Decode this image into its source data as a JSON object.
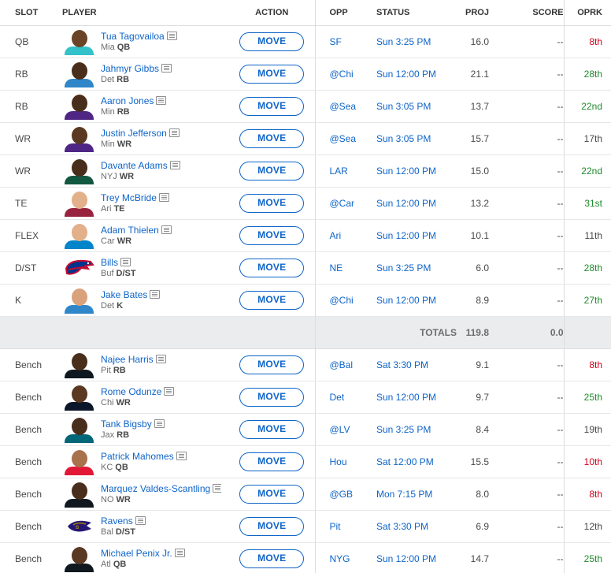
{
  "headers": {
    "slot": "SLOT",
    "player": "PLAYER",
    "action": "ACTION",
    "opp": "OPP",
    "status": "STATUS",
    "proj": "PROJ",
    "score": "SCORE",
    "oprk": "OPRK"
  },
  "move_label": "MOVE",
  "totals": {
    "label": "TOTALS",
    "proj": "119.8",
    "score": "0.0"
  },
  "starters": [
    {
      "slot": "QB",
      "name": "Tua Tagovailoa",
      "team": "Mia",
      "pos": "QB",
      "opp": "SF",
      "status": "Sun 3:25 PM",
      "proj": "16.0",
      "score": "--",
      "oprk": "8th",
      "oprk_tone": "red",
      "avatar": "headshot",
      "skin": "#6b4427",
      "jersey": "#33c2c9"
    },
    {
      "slot": "RB",
      "name": "Jahmyr Gibbs",
      "team": "Det",
      "pos": "RB",
      "opp": "@Chi",
      "status": "Sun 12:00 PM",
      "proj": "21.1",
      "score": "--",
      "oprk": "28th",
      "oprk_tone": "green",
      "avatar": "headshot",
      "skin": "#4a2e1c",
      "jersey": "#2f86c9"
    },
    {
      "slot": "RB",
      "name": "Aaron Jones",
      "team": "Min",
      "pos": "RB",
      "opp": "@Sea",
      "status": "Sun 3:05 PM",
      "proj": "13.7",
      "score": "--",
      "oprk": "22nd",
      "oprk_tone": "green",
      "avatar": "headshot",
      "skin": "#4a2e1c",
      "jersey": "#4f2683"
    },
    {
      "slot": "WR",
      "name": "Justin Jefferson",
      "team": "Min",
      "pos": "WR",
      "opp": "@Sea",
      "status": "Sun 3:05 PM",
      "proj": "15.7",
      "score": "--",
      "oprk": "17th",
      "oprk_tone": "neutral",
      "avatar": "headshot",
      "skin": "#5a3822",
      "jersey": "#4f2683"
    },
    {
      "slot": "WR",
      "name": "Davante Adams",
      "team": "NYJ",
      "pos": "WR",
      "opp": "LAR",
      "status": "Sun 12:00 PM",
      "proj": "15.0",
      "score": "--",
      "oprk": "22nd",
      "oprk_tone": "green",
      "avatar": "headshot",
      "skin": "#4a2e1c",
      "jersey": "#125740"
    },
    {
      "slot": "TE",
      "name": "Trey McBride",
      "team": "Ari",
      "pos": "TE",
      "opp": "@Car",
      "status": "Sun 12:00 PM",
      "proj": "13.2",
      "score": "--",
      "oprk": "31st",
      "oprk_tone": "green",
      "avatar": "headshot",
      "skin": "#e2b08a",
      "jersey": "#97233f"
    },
    {
      "slot": "FLEX",
      "name": "Adam Thielen",
      "team": "Car",
      "pos": "WR",
      "opp": "Ari",
      "status": "Sun 12:00 PM",
      "proj": "10.1",
      "score": "--",
      "oprk": "11th",
      "oprk_tone": "neutral",
      "avatar": "headshot",
      "skin": "#e2b08a",
      "jersey": "#0085ca"
    },
    {
      "slot": "D/ST",
      "name": "Bills",
      "team": "Buf",
      "pos": "D/ST",
      "opp": "NE",
      "status": "Sun 3:25 PM",
      "proj": "6.0",
      "score": "--",
      "oprk": "28th",
      "oprk_tone": "green",
      "avatar": "bills-logo",
      "skin": "",
      "jersey": ""
    },
    {
      "slot": "K",
      "name": "Jake Bates",
      "team": "Det",
      "pos": "K",
      "opp": "@Chi",
      "status": "Sun 12:00 PM",
      "proj": "8.9",
      "score": "--",
      "oprk": "27th",
      "oprk_tone": "green",
      "avatar": "headshot",
      "skin": "#d9a27c",
      "jersey": "#2f86c9"
    }
  ],
  "bench": [
    {
      "slot": "Bench",
      "name": "Najee Harris",
      "team": "Pit",
      "pos": "RB",
      "opp": "@Bal",
      "status": "Sat 3:30 PM",
      "proj": "9.1",
      "score": "--",
      "oprk": "8th",
      "oprk_tone": "red",
      "avatar": "headshot",
      "skin": "#4a2e1c",
      "jersey": "#101820"
    },
    {
      "slot": "Bench",
      "name": "Rome Odunze",
      "team": "Chi",
      "pos": "WR",
      "opp": "Det",
      "status": "Sun 12:00 PM",
      "proj": "9.7",
      "score": "--",
      "oprk": "25th",
      "oprk_tone": "green",
      "avatar": "headshot",
      "skin": "#5a3822",
      "jersey": "#0b162a"
    },
    {
      "slot": "Bench",
      "name": "Tank Bigsby",
      "team": "Jax",
      "pos": "RB",
      "opp": "@LV",
      "status": "Sun 3:25 PM",
      "proj": "8.4",
      "score": "--",
      "oprk": "19th",
      "oprk_tone": "neutral",
      "avatar": "headshot",
      "skin": "#4a2e1c",
      "jersey": "#006778"
    },
    {
      "slot": "Bench",
      "name": "Patrick Mahomes",
      "team": "KC",
      "pos": "QB",
      "opp": "Hou",
      "status": "Sat 12:00 PM",
      "proj": "15.5",
      "score": "--",
      "oprk": "10th",
      "oprk_tone": "red",
      "avatar": "headshot",
      "skin": "#a8724c",
      "jersey": "#e31837"
    },
    {
      "slot": "Bench",
      "name": "Marquez Valdes-Scantling",
      "team": "NO",
      "pos": "WR",
      "opp": "@GB",
      "status": "Mon 7:15 PM",
      "proj": "8.0",
      "score": "--",
      "oprk": "8th",
      "oprk_tone": "red",
      "avatar": "headshot",
      "skin": "#4a2e1c",
      "jersey": "#101820"
    },
    {
      "slot": "Bench",
      "name": "Ravens",
      "team": "Bal",
      "pos": "D/ST",
      "opp": "Pit",
      "status": "Sat 3:30 PM",
      "proj": "6.9",
      "score": "--",
      "oprk": "12th",
      "oprk_tone": "neutral",
      "avatar": "ravens-logo",
      "skin": "",
      "jersey": ""
    },
    {
      "slot": "Bench",
      "name": "Michael Penix Jr.",
      "team": "Atl",
      "pos": "QB",
      "opp": "NYG",
      "status": "Sun 12:00 PM",
      "proj": "14.7",
      "score": "--",
      "oprk": "25th",
      "oprk_tone": "green",
      "avatar": "headshot",
      "skin": "#5a3822",
      "jersey": "#101820"
    }
  ]
}
